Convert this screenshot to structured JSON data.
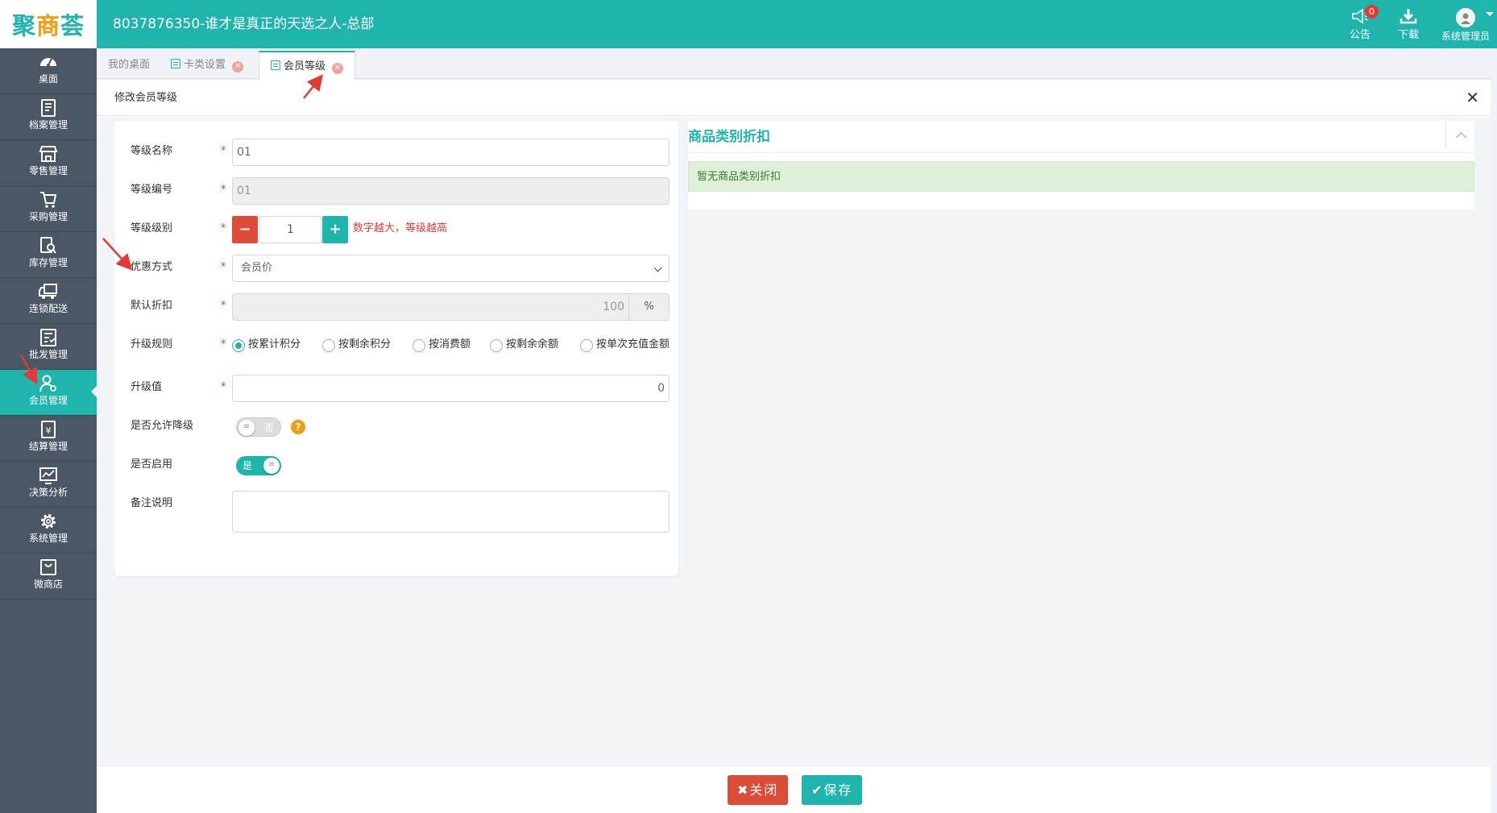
{
  "header": {
    "logo_main": "聚",
    "logo_accent": "商",
    "logo_tail": "荟",
    "store_title": "8037876350-谁才是真正的天选之人-总部",
    "notice_label": "公告",
    "notice_badge": "0",
    "download_label": "下载",
    "user_label": "系统管理员"
  },
  "sidebar": {
    "items": [
      {
        "label": "桌面",
        "icon": "dashboard-icon"
      },
      {
        "label": "档案管理",
        "icon": "archive-icon"
      },
      {
        "label": "零售管理",
        "icon": "store-icon"
      },
      {
        "label": "采购管理",
        "icon": "cart-icon"
      },
      {
        "label": "库存管理",
        "icon": "inventory-search-icon"
      },
      {
        "label": "连锁配送",
        "icon": "truck-icon"
      },
      {
        "label": "批发管理",
        "icon": "wholesale-icon"
      },
      {
        "label": "会员管理",
        "icon": "member-icon",
        "active": true
      },
      {
        "label": "结算管理",
        "icon": "settlement-icon"
      },
      {
        "label": "决策分析",
        "icon": "chart-icon"
      },
      {
        "label": "系统管理",
        "icon": "gear-icon"
      },
      {
        "label": "微商店",
        "icon": "shop-bag-icon"
      }
    ]
  },
  "tabs": [
    {
      "label": "我的桌面"
    },
    {
      "label": "卡类设置"
    },
    {
      "label": "会员等级",
      "active": true
    }
  ],
  "panel": {
    "title": "修改会员等级"
  },
  "form": {
    "level_name_label": "等级名称",
    "level_name_value": "01",
    "level_code_label": "等级编号",
    "level_code_value": "01",
    "level_rank_label": "等级级别",
    "level_rank_value": "1",
    "level_rank_hint": "数字越大，等级越高",
    "discount_mode_label": "优惠方式",
    "discount_mode_value": "会员价",
    "default_discount_label": "默认折扣",
    "default_discount_value": "100",
    "default_discount_unit": "%",
    "upgrade_rule_label": "升级规则",
    "upgrade_rules": [
      {
        "label": "按累计积分",
        "checked": true
      },
      {
        "label": "按剩余积分",
        "checked": false
      },
      {
        "label": "按消费额",
        "checked": false
      },
      {
        "label": "按剩余余额",
        "checked": false
      },
      {
        "label": "按单次充值金额",
        "checked": false
      }
    ],
    "upgrade_value_label": "升级值",
    "upgrade_value": "0",
    "allow_downgrade_label": "是否允许降级",
    "allow_downgrade_text": "否",
    "allow_downgrade_on": false,
    "enabled_label": "是否启用",
    "enabled_text": "是",
    "enabled_on": true,
    "remark_label": "备注说明",
    "required_mark": "*"
  },
  "category_discount": {
    "title": "商品类别折扣",
    "empty_text": "暂无商品类别折扣"
  },
  "footer": {
    "close_label": "关闭",
    "save_label": "保存"
  },
  "colors": {
    "primary": "#1fb4ac",
    "danger": "#dd4b39",
    "sidebar": "#4a5866",
    "warning": "#f39c12"
  }
}
